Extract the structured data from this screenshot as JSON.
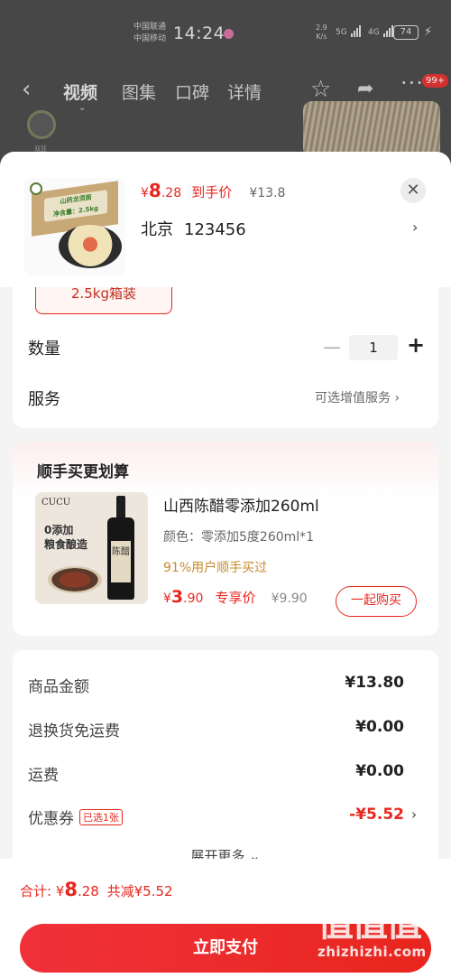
{
  "status_bar": {
    "carrier1": "中国联通",
    "carrier2": "中国移动",
    "time": "14:24",
    "speed_value": "2.9",
    "speed_unit": "K/s",
    "sig1": "5G",
    "sig2": "4G",
    "battery": "74"
  },
  "nav": {
    "tabs": [
      "视频",
      "图集",
      "口碑",
      "详情"
    ],
    "badge": "99+",
    "logo_caption": "双亚"
  },
  "product": {
    "box_text1": "山药龙须面",
    "box_text2": "净含量：2.5kg",
    "price_yen": "¥",
    "price_int": "8",
    "price_dec": ".28",
    "price_tag": "到手价",
    "orig_price": "¥13.8",
    "addr_city": "北京",
    "addr_code": "123456"
  },
  "spec": {
    "chip": "2.5kg箱装",
    "qty_label": "数量",
    "qty_value": "1",
    "service_label": "服务",
    "service_link": "可选增值服务"
  },
  "addon": {
    "title": "顺手买更划算",
    "brand": "CUCU",
    "img_line1": "0添加",
    "img_line2": "粮食酿造",
    "bottle_label": "陈醋",
    "name": "山西陈醋零添加260ml",
    "color": "颜色：零添加5度260ml*1",
    "social": "91%用户顺手买过",
    "price_yen": "¥",
    "price_int": "3",
    "price_dec": ".90",
    "price_tag": "专享价",
    "orig_price": "¥9.90",
    "buy_button": "一起购买"
  },
  "summary": {
    "rows": [
      {
        "label": "商品金额",
        "value": "¥13.80"
      },
      {
        "label": "退换货免运费",
        "value": "¥0.00"
      },
      {
        "label": "运费",
        "value": "¥0.00"
      },
      {
        "label": "优惠券",
        "tag": "已选1张",
        "value": "-¥5.52"
      }
    ],
    "expand": "展开更多"
  },
  "footer": {
    "total_prefix": "合计: ¥",
    "total_int": "8",
    "total_dec": ".28",
    "discount": "共减¥5.52",
    "pay_button": "立即支付"
  },
  "watermark": {
    "logo": "值值值",
    "url": "zhizhizhi.com"
  },
  "colors": {
    "accent": "#e8261e",
    "social_proof": "#c88a2c"
  },
  "icons": [
    "back-icon",
    "star-icon",
    "share-icon",
    "more-icon",
    "close-icon",
    "chevron-right-icon",
    "minus-icon",
    "plus-icon",
    "chevron-down-icon"
  ]
}
